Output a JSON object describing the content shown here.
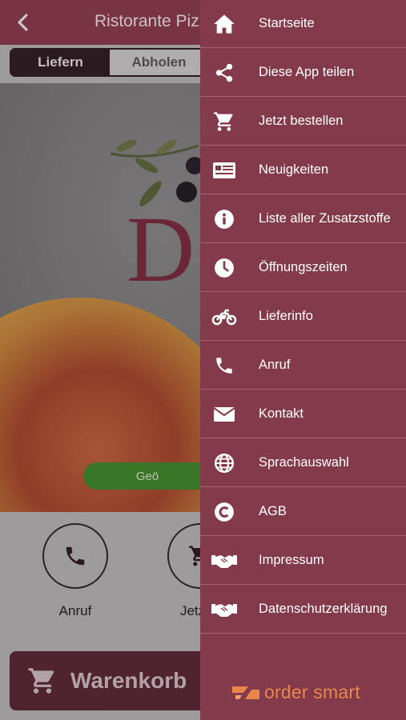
{
  "header": {
    "title": "Ristorante Pizze"
  },
  "order_mode": {
    "options": [
      "Liefern",
      "Abholen"
    ],
    "selected": "Liefern"
  },
  "hero": {
    "letter": "D",
    "status_badge": "Geö"
  },
  "actions": [
    {
      "label": "Anruf",
      "icon": "phone-icon"
    },
    {
      "label": "Jetzt b",
      "icon": "cart-icon"
    }
  ],
  "cart": {
    "label": "Warenkorb",
    "icon": "cart-icon"
  },
  "menu": {
    "items": [
      {
        "label": "Startseite",
        "icon": "home-icon"
      },
      {
        "label": "Diese App teilen",
        "icon": "share-icon"
      },
      {
        "label": "Jetzt bestellen",
        "icon": "cart-icon"
      },
      {
        "label": "Neuigkeiten",
        "icon": "news-icon"
      },
      {
        "label": "Liste aller Zusatzstoffe",
        "icon": "info-icon"
      },
      {
        "label": "Öffnungszeiten",
        "icon": "clock-icon"
      },
      {
        "label": "Lieferinfo",
        "icon": "motorcycle-icon"
      },
      {
        "label": "Anruf",
        "icon": "phone-icon"
      },
      {
        "label": "Kontakt",
        "icon": "mail-icon"
      },
      {
        "label": "Sprachauswahl",
        "icon": "globe-icon"
      },
      {
        "label": "AGB",
        "icon": "copyright-icon"
      },
      {
        "label": "Impressum",
        "icon": "handshake-icon"
      },
      {
        "label": "Datenschutzerklärung",
        "icon": "handshake-icon"
      }
    ]
  },
  "brand": {
    "name": "order smart"
  },
  "colors": {
    "drawer": "#833a4a",
    "header": "#8a3a4c",
    "brand": "#e9874a",
    "open_badge": "#3f8a2a"
  }
}
